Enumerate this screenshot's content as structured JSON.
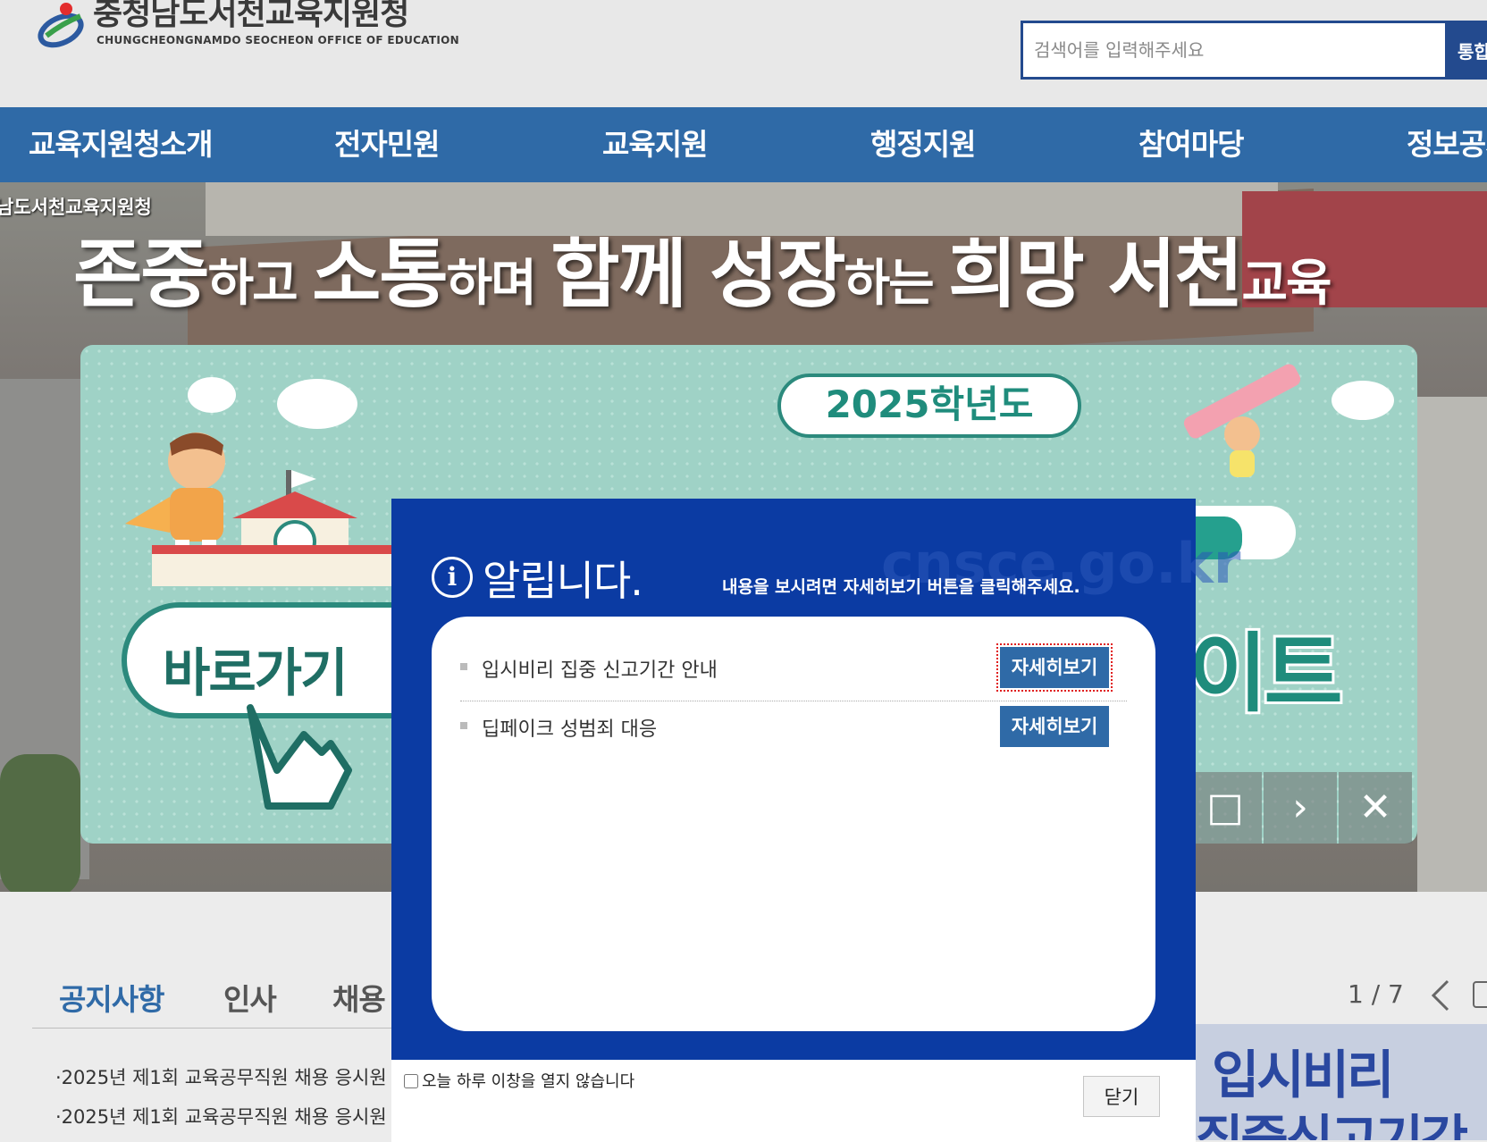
{
  "header": {
    "logo_ko": "충청남도서천교육지원청",
    "logo_en": "CHUNGCHEONGNAMDO SEOCHEON OFFICE OF EDUCATION",
    "search_placeholder": "검색어를 입력해주세요",
    "search_button": "통합"
  },
  "nav": [
    "교육지원청소개",
    "전자민원",
    "교육지원",
    "행정지원",
    "참여마당",
    "정보공개"
  ],
  "hero": {
    "caption": "남도서천교육지원청",
    "slogan": {
      "w1": "존중",
      "w2": "하고 ",
      "w3": "소통",
      "w4": "하며 ",
      "w5": "함께 ",
      "w6": "성장",
      "w7": "하는 ",
      "w8": "희망 ",
      "w9": "서천",
      "w10": "교육"
    }
  },
  "banner": {
    "year": "2025학년도",
    "go_text": "바로가기",
    "right_text": "이트",
    "controls": {
      "stop": "□",
      "next": "›",
      "close": "✕"
    }
  },
  "bottom": {
    "tabs": [
      "공지사항",
      "인사",
      "채용"
    ],
    "notices": [
      "·2025년 제1회 교육공무직원 채용 응시원",
      "·2025년 제1회 교육공무직원 채용 응시원"
    ],
    "pager": "1 / 7",
    "promo_line1": "입시비리",
    "promo_line2": "집중신고기간"
  },
  "popup": {
    "watermark": "cnsce.go.kr",
    "title": "알립니다.",
    "subtitle": "내용을 보시려면 자세히보기 버튼을 클릭해주세요.",
    "items": [
      {
        "label": "입시비리 집중 신고기간 안내",
        "button": "자세히보기"
      },
      {
        "label": "딥페이크 성범죄 대응",
        "button": "자세히보기"
      }
    ],
    "dont_show_today": "오늘 하루 이창을 열지 않습니다",
    "close_button": "닫기"
  },
  "colors": {
    "nav": "#2f6aa7",
    "popup": "#0b3ba3",
    "accent": "#234a8e",
    "banner": "#9fd2c6"
  }
}
